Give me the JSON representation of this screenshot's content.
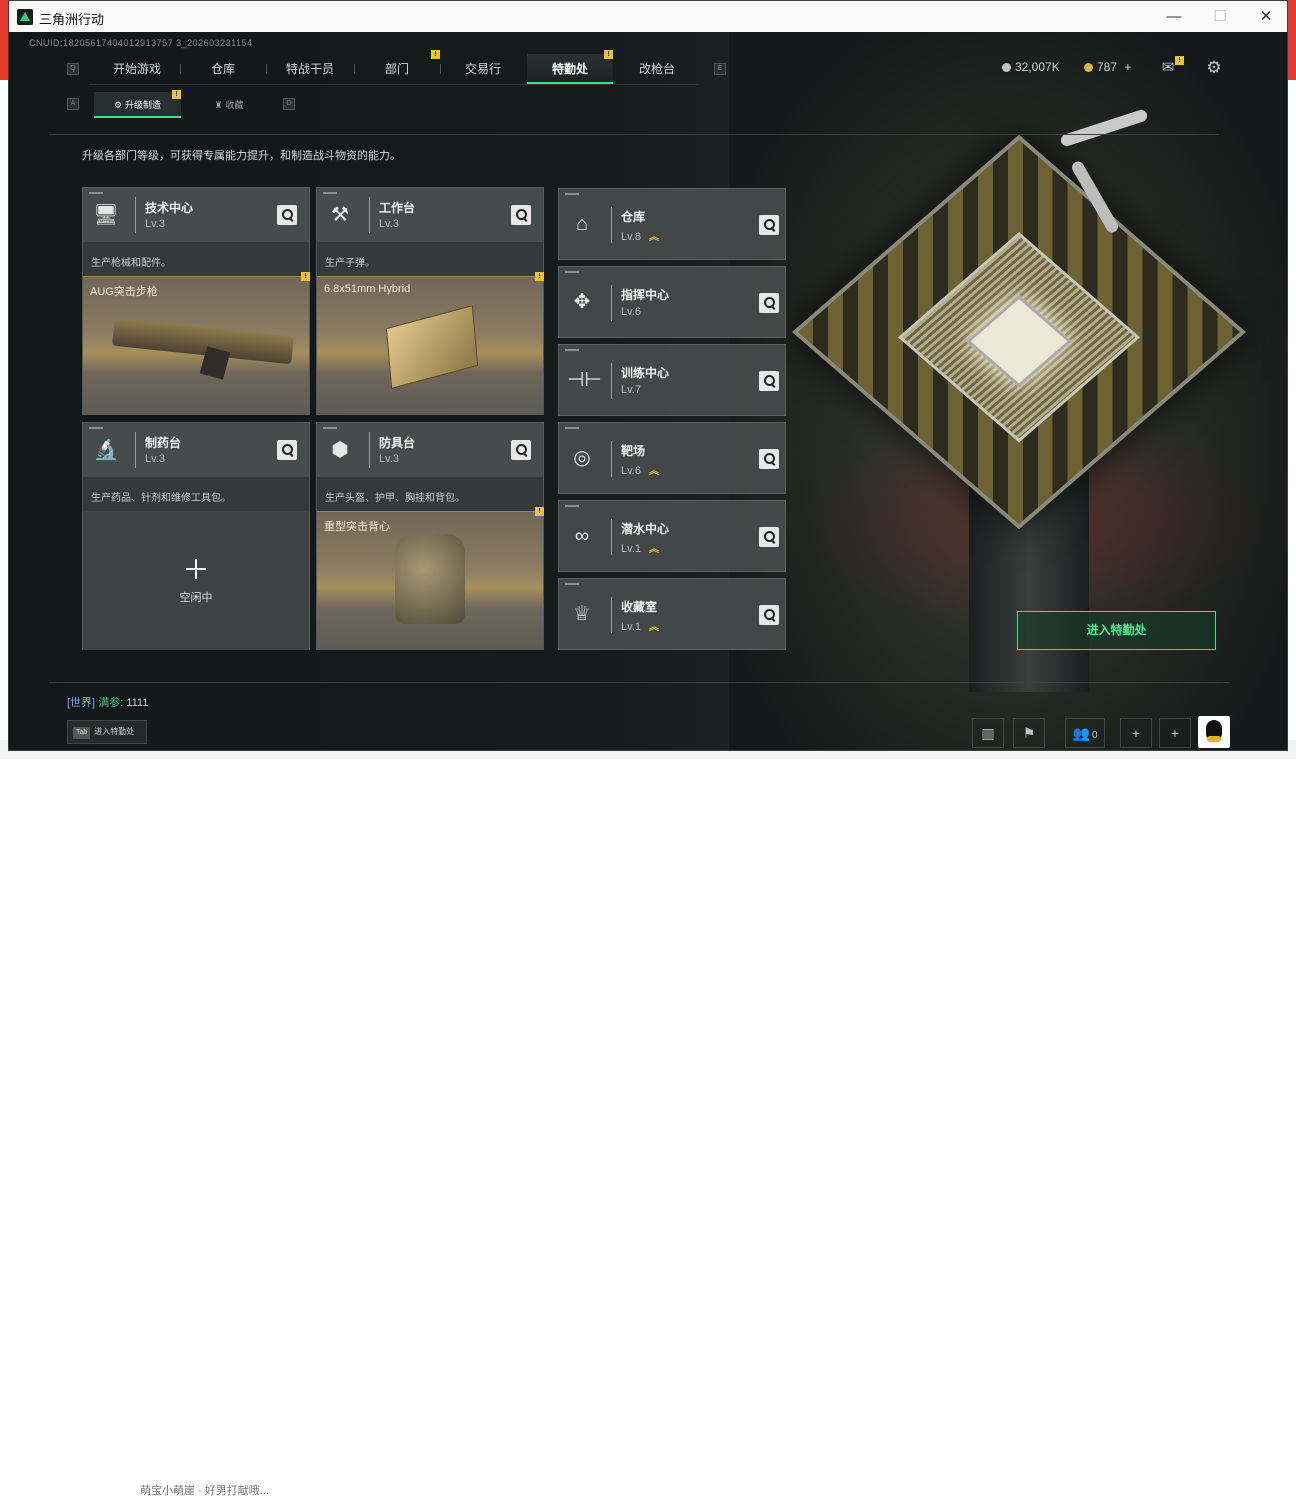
{
  "window": {
    "title": "三角洲行动",
    "controls": {
      "minimize": "—",
      "maximize": "☐",
      "close": "✕"
    }
  },
  "uid": "CNUID:18205617404012913757 3_202603231154",
  "nav": {
    "left_key": "Q",
    "right_key": "E",
    "tabs": [
      {
        "label": "开始游戏",
        "active": false,
        "badge": false
      },
      {
        "label": "仓库",
        "active": false,
        "badge": false
      },
      {
        "label": "特战干员",
        "active": false,
        "badge": false
      },
      {
        "label": "部门",
        "active": false,
        "badge": true
      },
      {
        "label": "交易行",
        "active": false,
        "badge": false
      },
      {
        "label": "特勤处",
        "active": true,
        "badge": true
      },
      {
        "label": "改枪台",
        "active": false,
        "badge": false
      }
    ],
    "badge_symbol": "!"
  },
  "currency": {
    "coins": "32,007K",
    "gold": "787",
    "gold_add": "+",
    "coins_color": "#bfc4c4",
    "gold_color": "#d8b54a"
  },
  "icons": {
    "mail": "mail-icon",
    "settings": "gear-icon"
  },
  "subnav": {
    "left_key": "A",
    "right_key": "D",
    "tabs": [
      {
        "label": "升级制造",
        "active": true,
        "badge": true
      },
      {
        "label": "收藏",
        "active": false,
        "badge": false
      }
    ]
  },
  "description": "升级各部门等级，可获得专属能力提升，和制造战斗物资的能力。",
  "workshops": [
    {
      "name": "技术中心",
      "level": "Lv.3",
      "sub": "生产枪械和配件。",
      "product": "AUG突击步枪",
      "icon": "computer-icon",
      "badge": true
    },
    {
      "name": "工作台",
      "level": "Lv.3",
      "sub": "生产子弹。",
      "product": "6.8x51mm Hybrid",
      "icon": "tools-icon",
      "badge": true
    },
    {
      "name": "制药台",
      "level": "Lv.3",
      "sub": "生产药品、针剂和维修工具包。",
      "product": "",
      "empty_label": "空闲中",
      "icon": "microscope-icon",
      "badge": false
    },
    {
      "name": "防具台",
      "level": "Lv.3",
      "sub": "生产头盔、护甲、胸挂和背包。",
      "product": "重型突击背心",
      "icon": "cubes-icon",
      "badge": true
    }
  ],
  "facilities": [
    {
      "name": "仓库",
      "level": "Lv.8",
      "upgrade": true,
      "icon": "warehouse-icon"
    },
    {
      "name": "指挥中心",
      "level": "Lv.6",
      "upgrade": false,
      "icon": "command-icon"
    },
    {
      "name": "训练中心",
      "level": "Lv.7",
      "upgrade": false,
      "icon": "dumbbell-icon"
    },
    {
      "name": "靶场",
      "level": "Lv.6",
      "upgrade": true,
      "icon": "target-icon"
    },
    {
      "name": "潜水中心",
      "level": "Lv.1",
      "upgrade": true,
      "icon": "goggles-icon"
    },
    {
      "name": "收藏室",
      "level": "Lv.1",
      "upgrade": true,
      "icon": "trophy-icon"
    }
  ],
  "upgrade_symbol": "︽",
  "enter_button": "进入特勤处",
  "chat": {
    "channel": "[世界]",
    "user": "满参:",
    "message": "1111"
  },
  "tab_hint": {
    "key": "Tab",
    "label": "进入特勤处"
  },
  "bottom": {
    "friends_count": "0"
  },
  "accent": "#2ee88e",
  "badge_color": "#e8c23a",
  "background_text": "萌宝小萌崖 · 好男打献哦..."
}
